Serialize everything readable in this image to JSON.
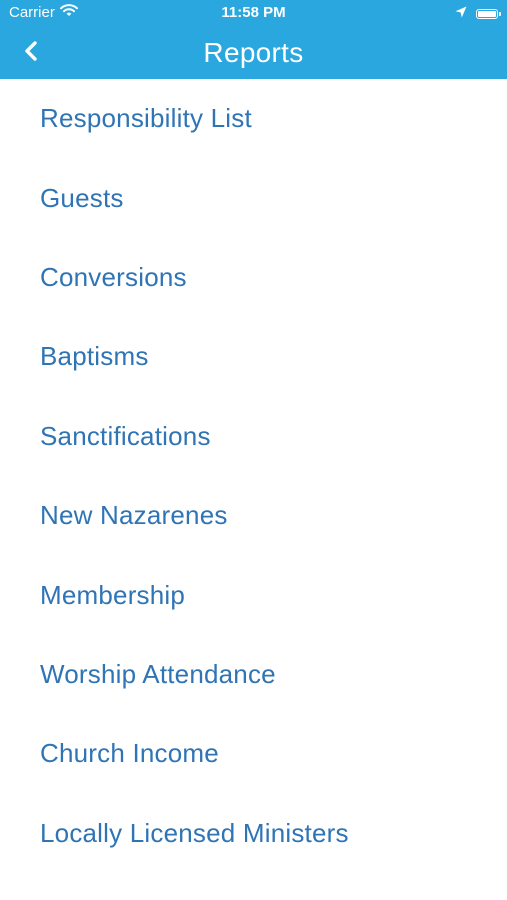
{
  "status_bar": {
    "carrier": "Carrier",
    "time": "11:58 PM",
    "icons": [
      "wifi-icon",
      "location-arrow-icon",
      "battery-icon"
    ]
  },
  "nav": {
    "title": "Reports",
    "back_icon": "chevron-left-icon"
  },
  "reports": [
    {
      "label": "Responsibility List"
    },
    {
      "label": "Guests"
    },
    {
      "label": "Conversions"
    },
    {
      "label": "Baptisms"
    },
    {
      "label": "Sanctifications"
    },
    {
      "label": "New Nazarenes"
    },
    {
      "label": "Membership"
    },
    {
      "label": "Worship Attendance"
    },
    {
      "label": "Church Income"
    },
    {
      "label": "Locally Licensed Ministers"
    }
  ],
  "colors": {
    "header": "#2aa7df",
    "item_text": "#2f74b5",
    "background": "#ffffff"
  }
}
